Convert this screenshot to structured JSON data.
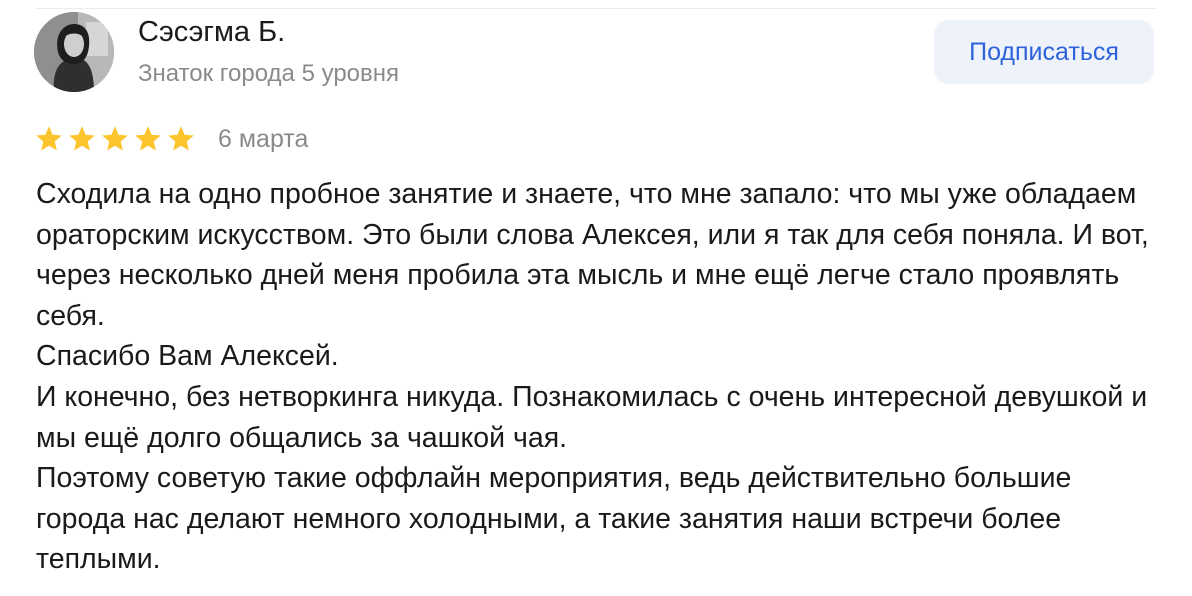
{
  "author": {
    "name": "Сэсэгма Б.",
    "level": "Знаток города 5 уровня",
    "avatar_icon": "user-photo-avatar"
  },
  "subscribe_button": {
    "label": "Подписаться",
    "color": "#2c63d9",
    "background": "#eef2fa"
  },
  "review": {
    "rating": 5,
    "rating_max": 5,
    "star_color": "#fcc42d",
    "date": "6 марта",
    "paragraphs": [
      "Сходила на одно пробное занятие и знаете, что мне запало: что мы уже обладаем ораторским искусством. Это были слова Алексея, или я так для себя поняла. И вот, через несколько дней меня пробила эта мысль и мне ещё легче стало проявлять себя.",
      "Спасибо Вам Алексей.",
      "И конечно, без нетворкинга никуда. Познакомилась с очень интересной девушкой и мы ещё долго общались за чашкой чая.",
      "Поэтому советую такие оффлайн мероприятия, ведь действительно большие города нас делают немного холодными, а такие занятия наши встречи более теплыми."
    ]
  }
}
